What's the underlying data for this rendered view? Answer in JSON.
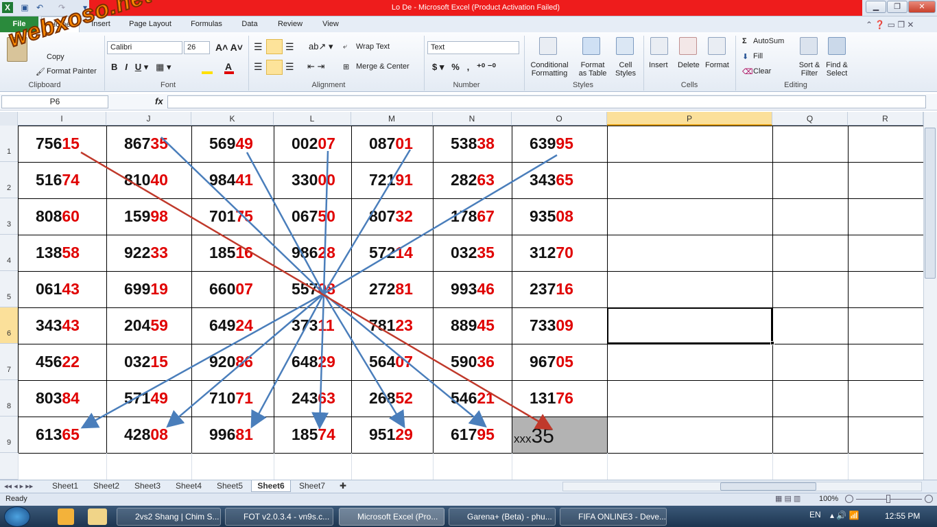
{
  "window": {
    "title": "Lo De  -  Microsoft Excel (Product Activation Failed)"
  },
  "watermark": "webxoso.net",
  "tabs": [
    "Home",
    "Insert",
    "Page Layout",
    "Formulas",
    "Data",
    "Review",
    "View"
  ],
  "file_tab": "File",
  "ribbon": {
    "clipboard": {
      "group": "Clipboard",
      "copy": "Copy",
      "format_painter": "Format Painter"
    },
    "font": {
      "group": "Font",
      "name": "Calibri",
      "size": "26"
    },
    "alignment": {
      "group": "Alignment",
      "wrap": "Wrap Text",
      "merge": "Merge & Center"
    },
    "number": {
      "group": "Number",
      "format": "Text"
    },
    "styles": {
      "group": "Styles",
      "cond1": "Conditional",
      "cond2": "Formatting",
      "fmt1": "Format",
      "fmt2": "as Table",
      "cell1": "Cell",
      "cell2": "Styles"
    },
    "cells": {
      "group": "Cells",
      "insert": "Insert",
      "delete": "Delete",
      "format": "Format"
    },
    "editing": {
      "group": "Editing",
      "autosum": "AutoSum",
      "fill": "Fill",
      "clear": "Clear",
      "sort1": "Sort &",
      "sort2": "Filter",
      "find1": "Find &",
      "find2": "Select"
    }
  },
  "namebox": "P6",
  "fx": "fx",
  "columns": [
    "I",
    "J",
    "K",
    "L",
    "M",
    "N",
    "O",
    "P",
    "Q",
    "R"
  ],
  "rows": [
    "1",
    "2",
    "3",
    "4",
    "5",
    "6",
    "7",
    "8",
    "9"
  ],
  "grid": [
    [
      [
        "756",
        "15"
      ],
      [
        "867",
        "35"
      ],
      [
        "569",
        "49"
      ],
      [
        "002",
        "07"
      ],
      [
        "087",
        "01"
      ],
      [
        "538",
        "38"
      ],
      [
        "639",
        "95"
      ]
    ],
    [
      [
        "516",
        "74"
      ],
      [
        "810",
        "40"
      ],
      [
        "984",
        "41"
      ],
      [
        "330",
        "00"
      ],
      [
        "721",
        "91"
      ],
      [
        "282",
        "63"
      ],
      [
        "343",
        "65"
      ]
    ],
    [
      [
        "808",
        "60"
      ],
      [
        "159",
        "98"
      ],
      [
        "701",
        "75"
      ],
      [
        "067",
        "50"
      ],
      [
        "807",
        "32"
      ],
      [
        "178",
        "67"
      ],
      [
        "935",
        "08"
      ]
    ],
    [
      [
        "138",
        "58"
      ],
      [
        "922",
        "33"
      ],
      [
        "185",
        "16"
      ],
      [
        "986",
        "28"
      ],
      [
        "572",
        "14"
      ],
      [
        "032",
        "35"
      ],
      [
        "312",
        "70"
      ]
    ],
    [
      [
        "061",
        "43"
      ],
      [
        "699",
        "19"
      ],
      [
        "660",
        "07"
      ],
      [
        "557",
        "08"
      ],
      [
        "272",
        "81"
      ],
      [
        "993",
        "46"
      ],
      [
        "237",
        "16"
      ]
    ],
    [
      [
        "343",
        "43"
      ],
      [
        "204",
        "59"
      ],
      [
        "649",
        "24"
      ],
      [
        "373",
        "11"
      ],
      [
        "781",
        "23"
      ],
      [
        "889",
        "45"
      ],
      [
        "733",
        "09"
      ]
    ],
    [
      [
        "456",
        "22"
      ],
      [
        "032",
        "15"
      ],
      [
        "920",
        "86"
      ],
      [
        "648",
        "29"
      ],
      [
        "564",
        "07"
      ],
      [
        "590",
        "36"
      ],
      [
        "967",
        "05"
      ]
    ],
    [
      [
        "803",
        "84"
      ],
      [
        "571",
        "49"
      ],
      [
        "710",
        "71"
      ],
      [
        "243",
        "63"
      ],
      [
        "268",
        "52"
      ],
      [
        "546",
        "21"
      ],
      [
        "131",
        "76"
      ]
    ],
    [
      [
        "613",
        "65"
      ],
      [
        "428",
        "08"
      ],
      [
        "996",
        "81"
      ],
      [
        "185",
        "74"
      ],
      [
        "951",
        "29"
      ],
      [
        "617",
        "95"
      ],
      [
        "xxx",
        "35"
      ]
    ]
  ],
  "sheets": [
    "Sheet1",
    "Sheet2",
    "Sheet3",
    "Sheet4",
    "Sheet5",
    "Sheet6",
    "Sheet7"
  ],
  "active_sheet": "Sheet6",
  "status": {
    "ready": "Ready",
    "zoom": "100%"
  },
  "taskbar": {
    "items": [
      "2vs2 Shang | Chim S...",
      "FOT v2.0.3.4 - vn9s.c...",
      "Microsoft Excel (Pro...",
      "Garena+ (Beta) - phu...",
      "FIFA ONLINE3 - Deve..."
    ],
    "lang": "EN",
    "time": "12:55 PM"
  }
}
